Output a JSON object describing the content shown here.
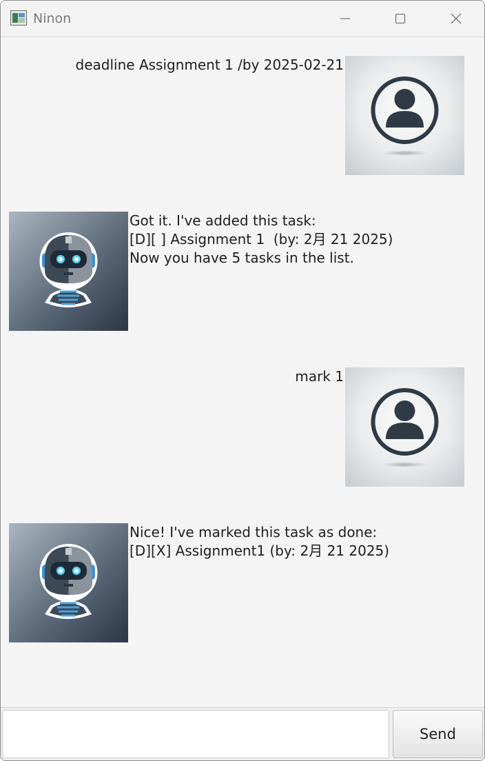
{
  "window": {
    "title": "Ninon",
    "controls": [
      "minimize-icon",
      "maximize-icon",
      "close-icon"
    ]
  },
  "messages": [
    {
      "sender": "user",
      "avatar": "user-avatar",
      "text": "deadline Assignment 1 /by 2025-02-21"
    },
    {
      "sender": "bot",
      "avatar": "robot-avatar",
      "text": "Got it. I've added this task:\n[D][ ] Assignment 1  (by: 2月 21 2025)\nNow you have 5 tasks in the list."
    },
    {
      "sender": "user",
      "avatar": "user-avatar",
      "text": "mark 1"
    },
    {
      "sender": "bot",
      "avatar": "robot-avatar",
      "text": "Nice! I've marked this task as done:\n[D][X] Assignment1 (by: 2月 21 2025)"
    }
  ],
  "input": {
    "value": "",
    "placeholder": ""
  },
  "send_label": "Send"
}
